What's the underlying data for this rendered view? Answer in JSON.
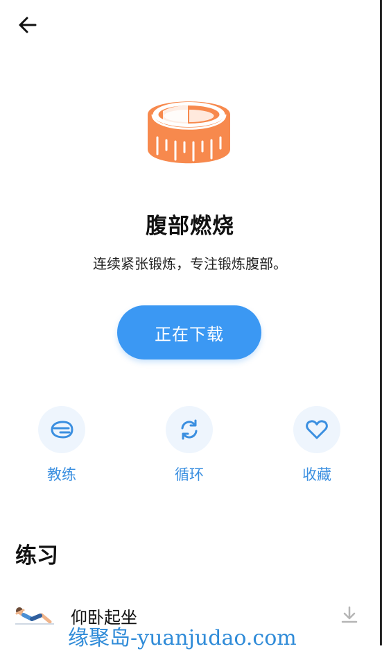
{
  "header": {
    "back_icon": "arrow-left-icon"
  },
  "hero": {
    "icon": "tape-measure-icon",
    "title": "腹部燃烧",
    "subtitle": "连续紧张锻炼，专注锻炼腹部。"
  },
  "download_button": {
    "label": "正在下载"
  },
  "actions": [
    {
      "label": "教练",
      "icon": "coach-whistle-icon"
    },
    {
      "label": "循环",
      "icon": "loop-icon"
    },
    {
      "label": "收藏",
      "icon": "heart-icon"
    }
  ],
  "exercises_section": {
    "title": "练习",
    "items": [
      {
        "name": "仰卧起坐",
        "thumbnail": "situp-figure-icon",
        "action_icon": "download-icon"
      }
    ]
  },
  "watermark": {
    "text": "缘聚岛-yuanjudao.com"
  },
  "colors": {
    "accent": "#3b98f3",
    "hero_orange": "#f5874f",
    "action_bg": "#eef5fd",
    "action_text": "#3b8fe0"
  }
}
